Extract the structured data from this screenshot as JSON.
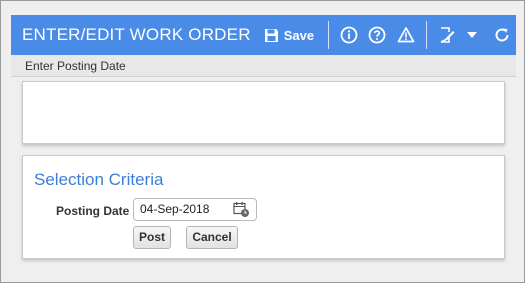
{
  "header": {
    "title": "ENTER/EDIT WORK ORDER",
    "save_label": "Save",
    "icons": [
      "save-icon",
      "info-icon",
      "help-icon",
      "warning-icon",
      "edit-note-icon",
      "dropdown-caret-icon",
      "refresh-icon"
    ],
    "background_color": "#4a8be8"
  },
  "subheader": {
    "text": "Enter Posting Date"
  },
  "selection_criteria": {
    "title": "Selection Criteria",
    "title_color": "#3b7fd9",
    "posting_date_label": "Posting Date",
    "posting_date_value": "04-Sep-2018",
    "post_label": "Post",
    "cancel_label": "Cancel"
  }
}
